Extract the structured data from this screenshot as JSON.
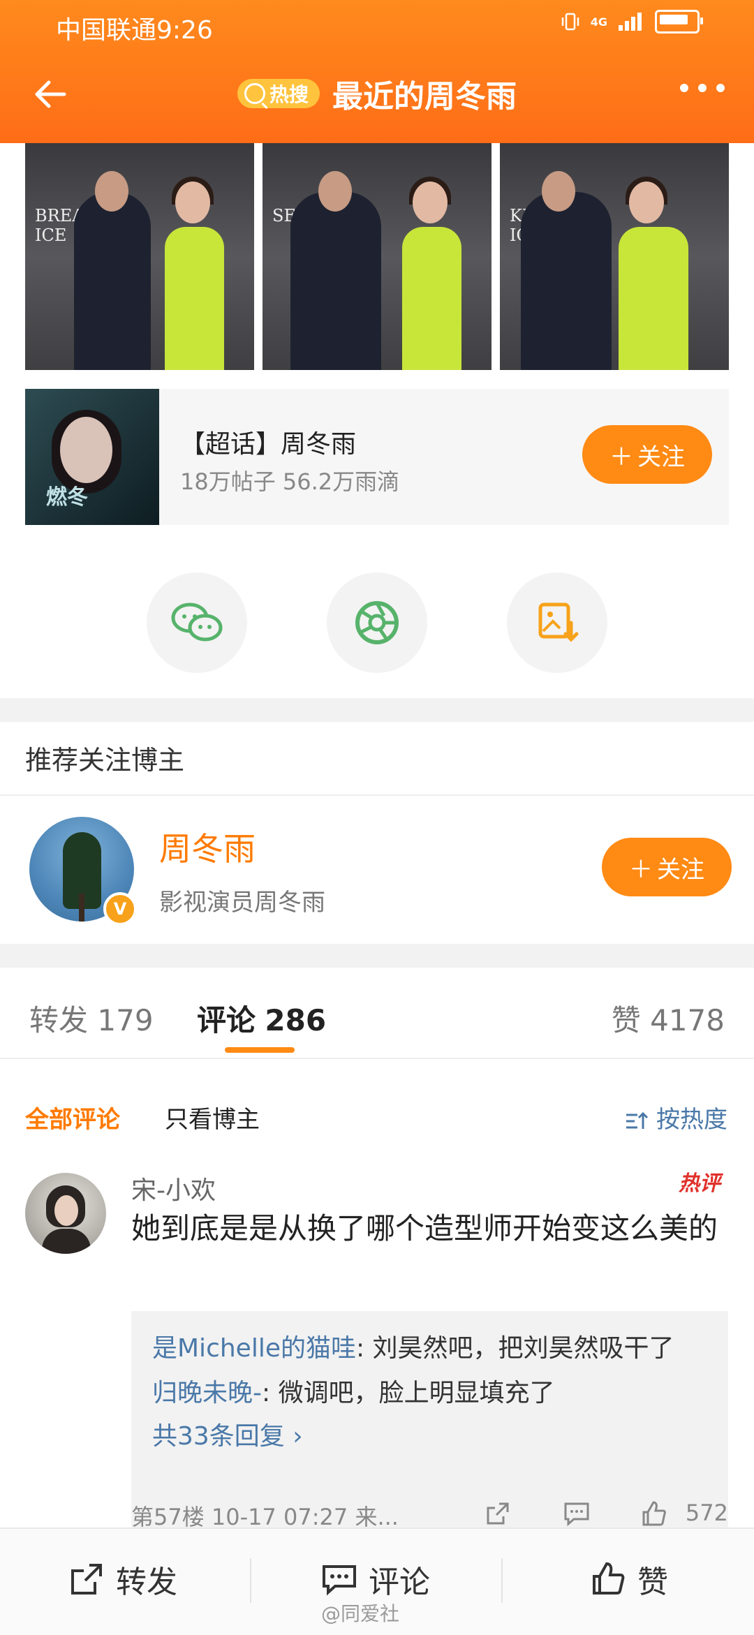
{
  "status_bar": {
    "carrier_time": "中国联通9:26",
    "network": "4G"
  },
  "header": {
    "hot_badge": "热搜",
    "title": "最近的周冬雨"
  },
  "topic": {
    "poster_title": "燃冬",
    "name": "【超话】周冬雨",
    "meta": "18万帖子 56.2万雨滴",
    "follow_label": "关注"
  },
  "share_icons": [
    "wechat-icon",
    "moments-icon",
    "save-image-icon"
  ],
  "recommend": {
    "section_title": "推荐关注博主",
    "name": "周冬雨",
    "desc": "影视演员周冬雨",
    "follow_label": "关注"
  },
  "tabs": {
    "repost_label": "转发",
    "repost_count": "179",
    "comment_label": "评论",
    "comment_count": "286",
    "like_label": "赞",
    "like_count": "4178"
  },
  "filter": {
    "all": "全部评论",
    "blogger_only": "只看博主",
    "sort": "按热度"
  },
  "comment": {
    "user": "宋-小欢",
    "hot_tag": "热评",
    "text": "她到底是是从换了哪个造型师开始变这么美的",
    "replies": [
      {
        "user": "是Michelle的猫哇",
        "text": ": 刘昊然吧，把刘昊然吸干了"
      },
      {
        "user": "归晚未晚-",
        "text": ": 微调吧，脸上明显填充了"
      }
    ],
    "more_replies": "共33条回复 ›",
    "meta": "第57楼 10-17 07:27 来...",
    "likes": "572"
  },
  "bottom_bar": {
    "repost": "转发",
    "comment": "评论",
    "like": "赞"
  },
  "watermark": "@同爱社",
  "colors": {
    "brand": "#ff7a00",
    "header": "#ff7f1a",
    "link": "#4a78a8"
  }
}
